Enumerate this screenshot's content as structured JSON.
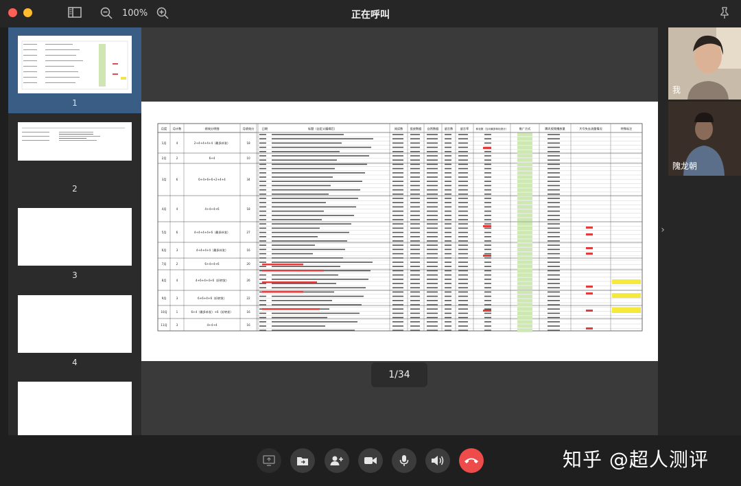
{
  "window": {
    "title": "正在呼叫",
    "zoom": "100%"
  },
  "sidebar": {
    "thumbnails": [
      {
        "label": "1",
        "active": true
      },
      {
        "label": "2",
        "active": false
      },
      {
        "label": "3",
        "active": false
      },
      {
        "label": "4",
        "active": false
      },
      {
        "label": "",
        "active": false
      }
    ]
  },
  "stage": {
    "page_indicator": "1/34"
  },
  "participants": [
    {
      "name": "我"
    },
    {
      "name": "隗龙朝"
    }
  ],
  "controls": {
    "share_screen": "share-screen",
    "file_share": "file",
    "add_member": "add-user",
    "camera": "camera",
    "microphone": "mic",
    "speaker": "speaker",
    "hangup": "hangup"
  },
  "watermark": "知乎 @超人测评",
  "slide_table": {
    "headers": [
      "月度",
      "月计数",
      "绩效分明细",
      "月绩效分",
      "日期",
      "标题（自定义编辑后）",
      "阅读数",
      "投放数据",
      "自然数据",
      "留言数",
      "留言率",
      "转化数（当月最多转化统计）",
      "推广方式",
      "腾讯视频播放量",
      "大号失去流量情况",
      "特殊标注"
    ],
    "sample_rows": [
      [
        "1月",
        "4",
        "2+4+4+4+4（最多补发）",
        "18",
        "1.05"
      ],
      [
        "2月",
        "2",
        "6+4",
        "10",
        "2.05"
      ],
      [
        "3月",
        "6",
        "6+4+6+6+2+4+4",
        "34",
        "3.05"
      ],
      [
        "4月",
        "4",
        "4+4+4+6",
        "18",
        "4.05"
      ],
      [
        "5月",
        "6",
        "4+4+4+4+6（最多补发）",
        "27",
        "5.05"
      ],
      [
        "6月",
        "3",
        "4+4+4+4（最多补发）",
        "16",
        "6.05"
      ],
      [
        "7月",
        "2",
        "6+4+4+6",
        "20",
        "7.05"
      ],
      [
        "8月",
        "4",
        "4+6+4+4+6（好转发）",
        "26",
        "8.05"
      ],
      [
        "9月",
        "3",
        "6+6+4+6（好转发）",
        "22",
        "9.05"
      ],
      [
        "10月",
        "1",
        "6+4（最多补发）+6（好转发）",
        "16",
        "10.25"
      ],
      [
        "11月",
        "3",
        "4+4+4",
        "16",
        "11.05"
      ]
    ]
  }
}
